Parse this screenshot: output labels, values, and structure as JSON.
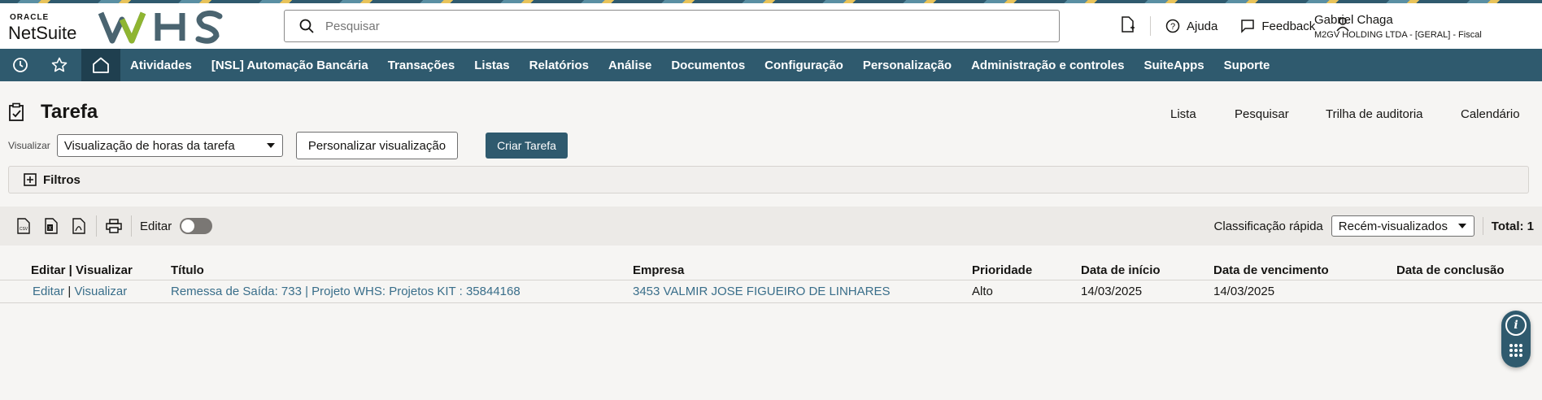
{
  "brand": {
    "oracle": "ORACLE",
    "netsuite": "NetSuite",
    "whs": "WHS"
  },
  "search": {
    "placeholder": "Pesquisar"
  },
  "header": {
    "help": "Ajuda",
    "feedback": "Feedback",
    "user_name": "Gabriel Chaga",
    "user_role": "M2GV HOLDING LTDA - [GERAL] - Fiscal"
  },
  "nav": {
    "items": [
      "Atividades",
      "[NSL] Automação Bancária",
      "Transações",
      "Listas",
      "Relatórios",
      "Análise",
      "Documentos",
      "Configuração",
      "Personalização",
      "Administração e controles",
      "SuiteApps",
      "Suporte"
    ]
  },
  "page": {
    "title": "Tarefa",
    "links": [
      "Lista",
      "Pesquisar",
      "Trilha de auditoria",
      "Calendário"
    ],
    "view_label": "Visualizar",
    "view_value": "Visualização de horas da tarefa",
    "customize_view": "Personalizar visualização",
    "create_task": "Criar Tarefa",
    "filters": "Filtros"
  },
  "toolbar": {
    "edit_label": "Editar",
    "quick_sort_label": "Classificação rápida",
    "quick_sort_value": "Recém-visualizados",
    "total": "Total: 1"
  },
  "table": {
    "headers": [
      "Editar | Visualizar",
      "Título",
      "Empresa",
      "Prioridade",
      "Data de início",
      "Data de vencimento",
      "Data de conclusão"
    ],
    "rows": [
      {
        "edit": "Editar",
        "sep": "|",
        "view": "Visualizar",
        "title": "Remessa de Saída: 733 | Projeto WHS: Projetos KIT : 35844168",
        "company": "3453 VALMIR JOSE FIGUEIRO DE LINHARES",
        "priority": "Alto",
        "start": "14/03/2025",
        "due": "14/03/2025",
        "completed": ""
      }
    ]
  },
  "colors": {
    "nav_bg": "#2f5a6e",
    "link": "#396e8a",
    "page_bg": "#f6f5f3"
  }
}
